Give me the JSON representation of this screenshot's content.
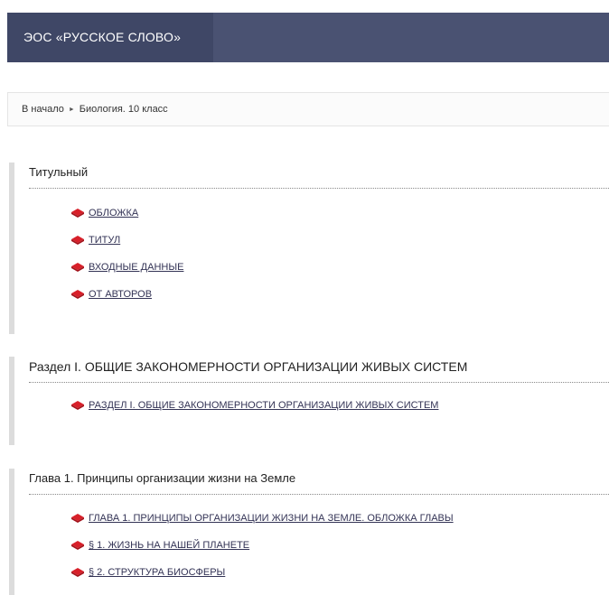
{
  "header": {
    "brand": "ЭОС «РУССКОЕ СЛОВО»"
  },
  "breadcrumb": {
    "home": "В начало",
    "separator": "►",
    "current": "Биология. 10 класс"
  },
  "sections": [
    {
      "title": "Титульный",
      "items": [
        "ОБЛОЖКА",
        "ТИТУЛ",
        "ВХОДНЫЕ ДАННЫЕ",
        "ОТ АВТОРОВ"
      ]
    },
    {
      "title": "Раздел I. ОБЩИЕ ЗАКОНОМЕРНОСТИ ОРГАНИЗАЦИИ ЖИВЫХ СИСТЕМ",
      "items": [
        "РАЗДЕЛ I. ОБЩИЕ ЗАКОНОМЕРНОСТИ ОРГАНИЗАЦИИ ЖИВЫХ СИСТЕМ"
      ]
    },
    {
      "title": "Глава 1. Принципы организации жизни на Земле",
      "items": [
        "ГЛАВА 1. ПРИНЦИПЫ ОРГАНИЗАЦИИ ЖИЗНИ НА ЗЕМЛЕ. ОБЛОЖКА ГЛАВЫ",
        "§ 1. ЖИЗНЬ НА НАШЕЙ ПЛАНЕТЕ",
        "§ 2. СТРУКТУРА БИОСФЕРЫ"
      ]
    }
  ],
  "icons": {
    "item_icon": "red-book-icon"
  },
  "colors": {
    "header_bg": "#4a5272",
    "brand_bg": "#3f4766",
    "icon_red": "#d8202a"
  }
}
